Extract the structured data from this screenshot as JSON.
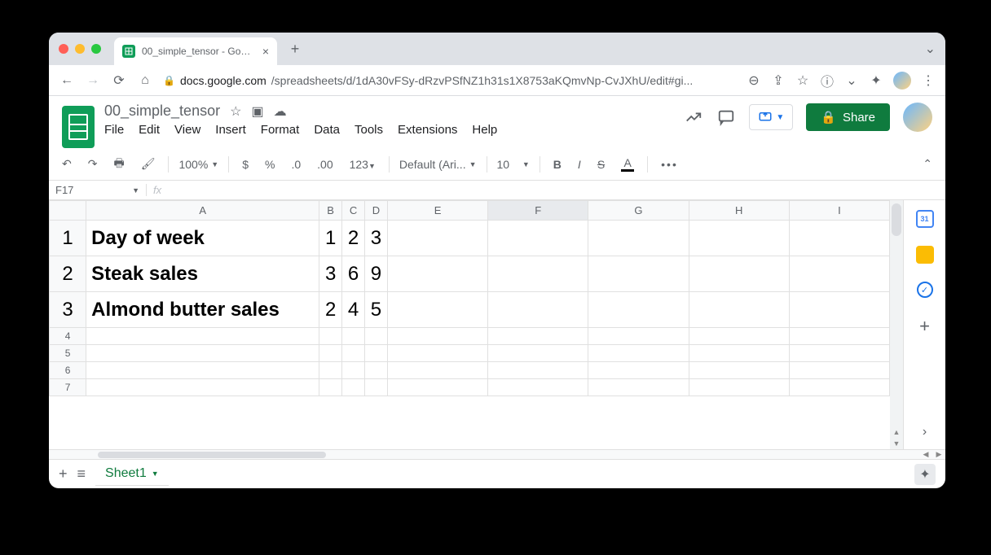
{
  "browser": {
    "tab_title": "00_simple_tensor - Google Sh",
    "url_domain": "docs.google.com",
    "url_path": "/spreadsheets/d/1dA30vFSy-dRzvPSfNZ1h31s1X8753aKQmvNp-CvJXhU/edit#gi..."
  },
  "doc": {
    "title": "00_simple_tensor",
    "menus": [
      "File",
      "Edit",
      "View",
      "Insert",
      "Format",
      "Data",
      "Tools",
      "Extensions",
      "Help"
    ],
    "share_label": "Share"
  },
  "toolbar": {
    "zoom": "100%",
    "format_123": "123",
    "font": "Default (Ari...",
    "font_size": "10"
  },
  "namebox": "F17",
  "fx_label": "fx",
  "columns": [
    "A",
    "B",
    "C",
    "D",
    "E",
    "F",
    "G",
    "H",
    "I"
  ],
  "rows": [
    {
      "n": 1,
      "label": "Day of week",
      "b": "1",
      "c": "2",
      "d": "3"
    },
    {
      "n": 2,
      "label": "Steak sales",
      "b": "3",
      "c": "6",
      "d": "9"
    },
    {
      "n": 3,
      "label": "Almond butter sales",
      "b": "2",
      "c": "4",
      "d": "5"
    }
  ],
  "empty_rows": [
    4,
    5,
    6,
    7
  ],
  "sheet_tab": "Sheet1"
}
